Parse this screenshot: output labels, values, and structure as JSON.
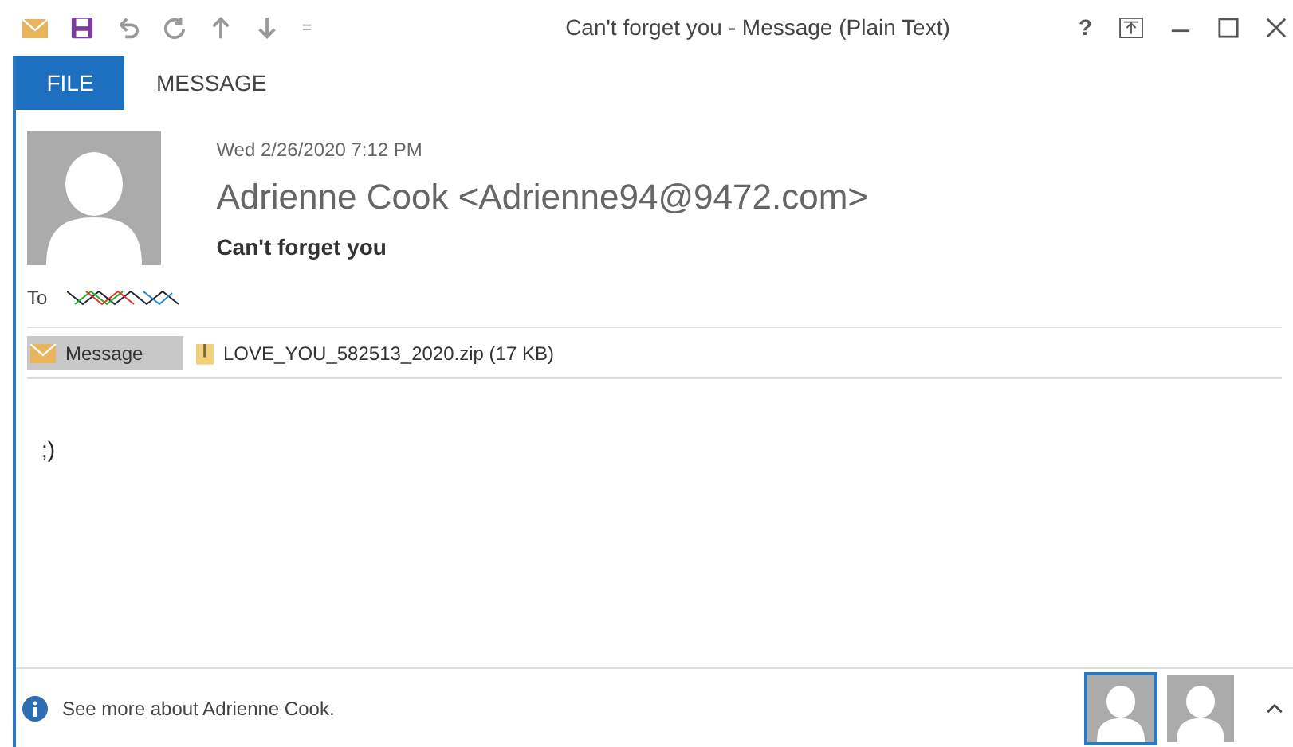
{
  "window": {
    "title": "Can't forget you - Message (Plain Text)",
    "help": "?"
  },
  "ribbon_tabs": [
    {
      "label": "FILE",
      "selected": true
    },
    {
      "label": "MESSAGE",
      "selected": false
    }
  ],
  "message": {
    "date": "Wed 2/26/2020 7:12 PM",
    "sender": "Adrienne Cook <Adrienne94@9472.com>",
    "subject": "Can't forget you",
    "to_label": "To"
  },
  "attachments": [
    {
      "kind": "message",
      "label": "Message",
      "selected": true
    },
    {
      "kind": "file",
      "label": "LOVE_YOU_582513_2020.zip (17 KB)",
      "selected": false
    }
  ],
  "body": ";)",
  "people_pane": {
    "text": "See more about Adrienne Cook.",
    "contacts": [
      {
        "selected": true
      },
      {
        "selected": false
      }
    ]
  }
}
